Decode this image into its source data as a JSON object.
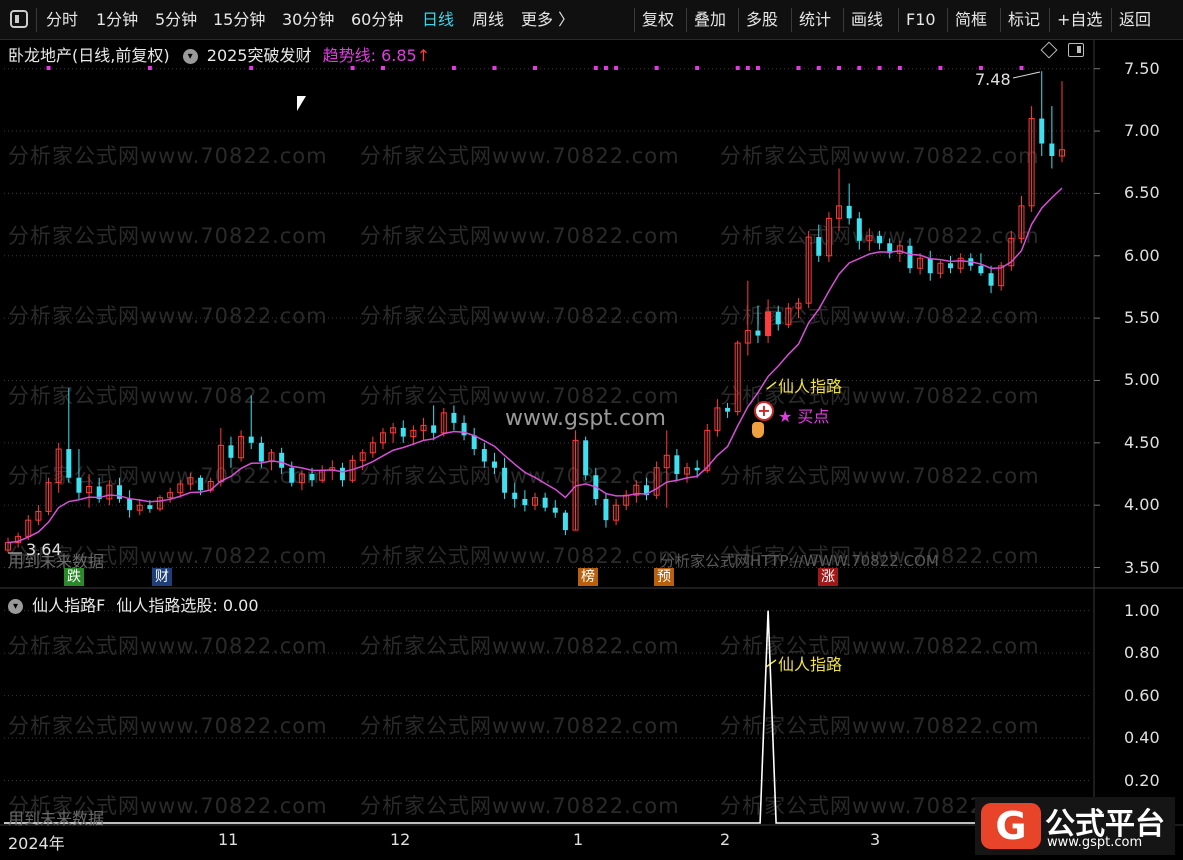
{
  "toolbar": {
    "left_items": [
      {
        "label": "分时",
        "active": false
      },
      {
        "label": "1分钟",
        "active": false
      },
      {
        "label": "5分钟",
        "active": false
      },
      {
        "label": "15分钟",
        "active": false
      },
      {
        "label": "30分钟",
        "active": false
      },
      {
        "label": "60分钟",
        "active": false
      },
      {
        "label": "日线",
        "active": true
      },
      {
        "label": "周线",
        "active": false
      },
      {
        "label": "更多 〉",
        "active": false
      }
    ],
    "right_items": [
      "复权",
      "叠加",
      "多股",
      "统计",
      "画线",
      "F10",
      "简框",
      "标记",
      "+自选",
      "返回"
    ]
  },
  "main_panel": {
    "stock_title": "卧龙地产(日线,前复权)",
    "indicator_name": "2025突破发财",
    "trend_label": "趋势线: 6.85",
    "trend_arrow": "↑",
    "high_label": "7.48",
    "low_label": "3.64",
    "signal_label": "仙人指路",
    "buy_label": "★ 买点",
    "watermark_center": "www.gspt.com",
    "watermark_bottom": "分析家公式网HTTP://WWW.70822.COM",
    "future_data_note": "用到未来数据",
    "y_ticks": [
      "7.50",
      "7.00",
      "6.50",
      "6.00",
      "5.50",
      "5.00",
      "4.50",
      "4.00",
      "3.50"
    ],
    "badges": [
      {
        "text": "跌",
        "color": "#2a8a2a"
      },
      {
        "text": "财",
        "color": "#1f3f7a"
      },
      {
        "text": "榜",
        "color": "#b8600e"
      },
      {
        "text": "预",
        "color": "#b8600e"
      },
      {
        "text": "涨",
        "color": "#a01818"
      }
    ]
  },
  "sub_panel": {
    "title": "仙人指路F",
    "value_label": "仙人指路选股: 0.00",
    "signal_label": "仙人指路",
    "future_data_note": "用到未来数据",
    "y_ticks": [
      "1.00",
      "0.80",
      "0.60",
      "0.40",
      "0.20"
    ]
  },
  "x_axis": {
    "labels": [
      "2024年",
      "11",
      "12",
      "1",
      "2",
      "3"
    ]
  },
  "watermark_text": "分析家公式网www.70822.com",
  "logo": {
    "glyph": "G",
    "title": "公式平台",
    "url": "www.gspt.com"
  },
  "colors": {
    "up": "#ff3b3b",
    "down": "#3fe0f0",
    "trend": "#d64fd6",
    "dots": "#e03ce0",
    "signal": "#f0e040",
    "accent": "#3fd4e8"
  },
  "chart_data": {
    "type": "candlestick",
    "ylim": [
      3.4,
      7.65
    ],
    "y_ticks": [
      3.5,
      4.0,
      4.5,
      5.0,
      5.5,
      6.0,
      6.5,
      7.0,
      7.5
    ],
    "x_period_labels": [
      "2024年",
      "11",
      "12",
      "1",
      "2",
      "3"
    ],
    "candles": [
      {
        "o": 3.64,
        "h": 3.74,
        "l": 3.62,
        "c": 3.7
      },
      {
        "o": 3.7,
        "h": 3.78,
        "l": 3.66,
        "c": 3.75
      },
      {
        "o": 3.75,
        "h": 3.92,
        "l": 3.72,
        "c": 3.88
      },
      {
        "o": 3.88,
        "h": 4.0,
        "l": 3.84,
        "c": 3.95
      },
      {
        "o": 3.95,
        "h": 4.22,
        "l": 3.92,
        "c": 4.18
      },
      {
        "o": 4.18,
        "h": 4.5,
        "l": 4.1,
        "c": 4.45
      },
      {
        "o": 4.45,
        "h": 4.94,
        "l": 4.18,
        "c": 4.22
      },
      {
        "o": 4.22,
        "h": 4.45,
        "l": 4.05,
        "c": 4.1
      },
      {
        "o": 4.1,
        "h": 4.25,
        "l": 3.98,
        "c": 4.15
      },
      {
        "o": 4.15,
        "h": 4.22,
        "l": 4.02,
        "c": 4.05
      },
      {
        "o": 4.05,
        "h": 4.2,
        "l": 4.0,
        "c": 4.16
      },
      {
        "o": 4.16,
        "h": 4.22,
        "l": 4.02,
        "c": 4.05
      },
      {
        "o": 4.05,
        "h": 4.12,
        "l": 3.9,
        "c": 3.96
      },
      {
        "o": 3.96,
        "h": 4.05,
        "l": 3.92,
        "c": 4.0
      },
      {
        "o": 4.0,
        "h": 4.04,
        "l": 3.94,
        "c": 3.97
      },
      {
        "o": 3.97,
        "h": 4.08,
        "l": 3.95,
        "c": 4.06
      },
      {
        "o": 4.06,
        "h": 4.14,
        "l": 4.02,
        "c": 4.1
      },
      {
        "o": 4.1,
        "h": 4.2,
        "l": 4.06,
        "c": 4.17
      },
      {
        "o": 4.17,
        "h": 4.26,
        "l": 4.12,
        "c": 4.22
      },
      {
        "o": 4.22,
        "h": 4.24,
        "l": 4.08,
        "c": 4.12
      },
      {
        "o": 4.12,
        "h": 4.22,
        "l": 4.1,
        "c": 4.19
      },
      {
        "o": 4.19,
        "h": 4.62,
        "l": 4.15,
        "c": 4.48
      },
      {
        "o": 4.48,
        "h": 4.55,
        "l": 4.3,
        "c": 4.38
      },
      {
        "o": 4.38,
        "h": 4.6,
        "l": 4.35,
        "c": 4.55
      },
      {
        "o": 4.55,
        "h": 4.88,
        "l": 4.45,
        "c": 4.5
      },
      {
        "o": 4.5,
        "h": 4.55,
        "l": 4.3,
        "c": 4.35
      },
      {
        "o": 4.35,
        "h": 4.45,
        "l": 4.28,
        "c": 4.42
      },
      {
        "o": 4.42,
        "h": 4.46,
        "l": 4.25,
        "c": 4.3
      },
      {
        "o": 4.3,
        "h": 4.35,
        "l": 4.15,
        "c": 4.18
      },
      {
        "o": 4.18,
        "h": 4.28,
        "l": 4.12,
        "c": 4.25
      },
      {
        "o": 4.25,
        "h": 4.3,
        "l": 4.15,
        "c": 4.2
      },
      {
        "o": 4.2,
        "h": 4.32,
        "l": 4.18,
        "c": 4.28
      },
      {
        "o": 4.28,
        "h": 4.36,
        "l": 4.2,
        "c": 4.3
      },
      {
        "o": 4.3,
        "h": 4.34,
        "l": 4.15,
        "c": 4.2
      },
      {
        "o": 4.2,
        "h": 4.4,
        "l": 4.18,
        "c": 4.36
      },
      {
        "o": 4.36,
        "h": 4.45,
        "l": 4.28,
        "c": 4.42
      },
      {
        "o": 4.42,
        "h": 4.55,
        "l": 4.38,
        "c": 4.5
      },
      {
        "o": 4.5,
        "h": 4.62,
        "l": 4.45,
        "c": 4.58
      },
      {
        "o": 4.58,
        "h": 4.66,
        "l": 4.5,
        "c": 4.62
      },
      {
        "o": 4.62,
        "h": 4.68,
        "l": 4.5,
        "c": 4.55
      },
      {
        "o": 4.55,
        "h": 4.64,
        "l": 4.48,
        "c": 4.6
      },
      {
        "o": 4.6,
        "h": 4.7,
        "l": 4.52,
        "c": 4.64
      },
      {
        "o": 4.64,
        "h": 4.8,
        "l": 4.52,
        "c": 4.58
      },
      {
        "o": 4.58,
        "h": 4.78,
        "l": 4.55,
        "c": 4.74
      },
      {
        "o": 4.74,
        "h": 4.8,
        "l": 4.6,
        "c": 4.66
      },
      {
        "o": 4.66,
        "h": 4.72,
        "l": 4.52,
        "c": 4.56
      },
      {
        "o": 4.56,
        "h": 4.62,
        "l": 4.4,
        "c": 4.45
      },
      {
        "o": 4.45,
        "h": 4.5,
        "l": 4.3,
        "c": 4.35
      },
      {
        "o": 4.35,
        "h": 4.42,
        "l": 4.25,
        "c": 4.3
      },
      {
        "o": 4.3,
        "h": 4.38,
        "l": 4.05,
        "c": 4.1
      },
      {
        "o": 4.1,
        "h": 4.18,
        "l": 3.98,
        "c": 4.05
      },
      {
        "o": 4.05,
        "h": 4.12,
        "l": 3.95,
        "c": 4.0
      },
      {
        "o": 4.0,
        "h": 4.1,
        "l": 3.96,
        "c": 4.06
      },
      {
        "o": 4.06,
        "h": 4.1,
        "l": 3.95,
        "c": 3.98
      },
      {
        "o": 3.98,
        "h": 4.04,
        "l": 3.9,
        "c": 3.94
      },
      {
        "o": 3.94,
        "h": 3.96,
        "l": 3.76,
        "c": 3.8
      },
      {
        "o": 3.8,
        "h": 4.6,
        "l": 3.8,
        "c": 4.52
      },
      {
        "o": 4.52,
        "h": 4.55,
        "l": 4.2,
        "c": 4.24
      },
      {
        "o": 4.24,
        "h": 4.3,
        "l": 4.0,
        "c": 4.05
      },
      {
        "o": 4.05,
        "h": 4.1,
        "l": 3.82,
        "c": 3.88
      },
      {
        "o": 3.88,
        "h": 4.05,
        "l": 3.84,
        "c": 4.0
      },
      {
        "o": 4.0,
        "h": 4.12,
        "l": 3.96,
        "c": 4.08
      },
      {
        "o": 4.08,
        "h": 4.2,
        "l": 4.02,
        "c": 4.16
      },
      {
        "o": 4.16,
        "h": 4.22,
        "l": 4.04,
        "c": 4.08
      },
      {
        "o": 4.08,
        "h": 4.35,
        "l": 4.05,
        "c": 4.3
      },
      {
        "o": 4.3,
        "h": 4.6,
        "l": 3.98,
        "c": 4.4
      },
      {
        "o": 4.4,
        "h": 4.45,
        "l": 4.2,
        "c": 4.25
      },
      {
        "o": 4.25,
        "h": 4.34,
        "l": 4.18,
        "c": 4.3
      },
      {
        "o": 4.3,
        "h": 4.36,
        "l": 4.22,
        "c": 4.28
      },
      {
        "o": 4.28,
        "h": 4.65,
        "l": 4.26,
        "c": 4.6
      },
      {
        "o": 4.6,
        "h": 4.85,
        "l": 4.55,
        "c": 4.78
      },
      {
        "o": 4.78,
        "h": 4.82,
        "l": 4.7,
        "c": 4.75
      },
      {
        "o": 4.75,
        "h": 5.32,
        "l": 4.72,
        "c": 5.3
      },
      {
        "o": 5.3,
        "h": 5.8,
        "l": 5.2,
        "c": 5.4
      },
      {
        "o": 5.4,
        "h": 5.6,
        "l": 5.3,
        "c": 5.36
      },
      {
        "o": 5.36,
        "h": 5.65,
        "l": 5.3,
        "c": 5.55
      },
      {
        "o": 5.55,
        "h": 5.6,
        "l": 5.4,
        "c": 5.45
      },
      {
        "o": 5.45,
        "h": 5.62,
        "l": 5.42,
        "c": 5.58
      },
      {
        "o": 5.58,
        "h": 5.66,
        "l": 5.5,
        "c": 5.62
      },
      {
        "o": 5.62,
        "h": 6.2,
        "l": 5.58,
        "c": 6.15
      },
      {
        "o": 6.15,
        "h": 6.25,
        "l": 5.95,
        "c": 6.0
      },
      {
        "o": 6.0,
        "h": 6.35,
        "l": 5.95,
        "c": 6.3
      },
      {
        "o": 6.3,
        "h": 6.7,
        "l": 6.2,
        "c": 6.4
      },
      {
        "o": 6.4,
        "h": 6.58,
        "l": 6.25,
        "c": 6.3
      },
      {
        "o": 6.3,
        "h": 6.35,
        "l": 6.05,
        "c": 6.12
      },
      {
        "o": 6.12,
        "h": 6.22,
        "l": 6.04,
        "c": 6.16
      },
      {
        "o": 6.16,
        "h": 6.2,
        "l": 6.05,
        "c": 6.1
      },
      {
        "o": 6.1,
        "h": 6.14,
        "l": 5.98,
        "c": 6.02
      },
      {
        "o": 6.02,
        "h": 6.12,
        "l": 5.95,
        "c": 6.08
      },
      {
        "o": 6.08,
        "h": 6.14,
        "l": 5.86,
        "c": 5.9
      },
      {
        "o": 5.9,
        "h": 6.02,
        "l": 5.85,
        "c": 5.98
      },
      {
        "o": 5.98,
        "h": 6.04,
        "l": 5.8,
        "c": 5.86
      },
      {
        "o": 5.86,
        "h": 5.96,
        "l": 5.82,
        "c": 5.94
      },
      {
        "o": 5.94,
        "h": 6.0,
        "l": 5.86,
        "c": 5.9
      },
      {
        "o": 5.9,
        "h": 6.02,
        "l": 5.86,
        "c": 5.98
      },
      {
        "o": 5.98,
        "h": 6.02,
        "l": 5.88,
        "c": 5.92
      },
      {
        "o": 5.92,
        "h": 6.02,
        "l": 5.84,
        "c": 5.86
      },
      {
        "o": 5.86,
        "h": 5.92,
        "l": 5.7,
        "c": 5.76
      },
      {
        "o": 5.76,
        "h": 5.95,
        "l": 5.72,
        "c": 5.92
      },
      {
        "o": 5.92,
        "h": 6.2,
        "l": 5.88,
        "c": 6.14
      },
      {
        "o": 6.14,
        "h": 6.48,
        "l": 6.1,
        "c": 6.4
      },
      {
        "o": 6.4,
        "h": 7.2,
        "l": 6.35,
        "c": 7.1
      },
      {
        "o": 7.1,
        "h": 7.48,
        "l": 6.8,
        "c": 6.9
      },
      {
        "o": 6.9,
        "h": 7.2,
        "l": 6.7,
        "c": 6.8
      },
      {
        "o": 6.8,
        "h": 7.4,
        "l": 6.75,
        "c": 6.85
      }
    ],
    "trend_line_last": 6.85,
    "signal": {
      "label": "仙人指路",
      "candle_index": 75,
      "sub_value": 1.0
    },
    "sub_ylim": [
      0,
      1.05
    ]
  }
}
